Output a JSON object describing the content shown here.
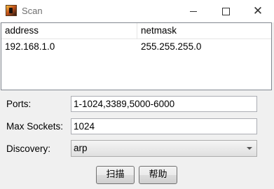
{
  "window": {
    "title": "Scan"
  },
  "table": {
    "columns": [
      "address",
      "netmask"
    ],
    "rows": [
      {
        "address": "192.168.1.0",
        "netmask": "255.255.255.0"
      }
    ]
  },
  "form": {
    "ports_label": "Ports:",
    "ports_value": "1-1024,3389,5000-6000",
    "max_sockets_label": "Max Sockets:",
    "max_sockets_value": "1024",
    "discovery_label": "Discovery:",
    "discovery_value": "arp"
  },
  "buttons": {
    "scan_label": "扫描",
    "help_label": "帮助"
  },
  "icons": {
    "app": "app-icon",
    "minimize": "minimize-icon",
    "maximize": "maximize-icon",
    "close": "close-icon",
    "dropdown": "chevron-down-icon"
  }
}
